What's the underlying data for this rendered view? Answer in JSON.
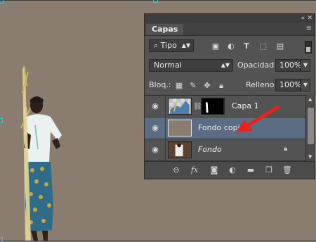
{
  "panel": {
    "tab_label": "Capas",
    "collapse_icon": "double-chevron-left-icon",
    "close_icon": "close-icon",
    "menu_icon": "panel-menu-icon"
  },
  "filter": {
    "type_label": "Tipo",
    "icons": [
      "image-filter-icon",
      "adjustment-filter-icon",
      "text-filter-icon",
      "shape-filter-icon",
      "smart-object-filter-icon"
    ]
  },
  "blend": {
    "mode": "Normal",
    "opacity_label": "Opacidad:",
    "opacity_value": "100%"
  },
  "lock": {
    "label": "Bloq.:",
    "fill_label": "Relleno:",
    "fill_value": "100%"
  },
  "layers": [
    {
      "name": "Capa 1",
      "selected": false,
      "has_mask": true,
      "locked": false
    },
    {
      "name": "Fondo copia",
      "selected": true,
      "has_mask": false,
      "locked": false
    },
    {
      "name": "Fondo",
      "selected": false,
      "has_mask": false,
      "locked": true
    }
  ],
  "bottom_icons": [
    "link-layers-icon",
    "fx-icon",
    "add-mask-icon",
    "adjustment-layer-icon",
    "new-group-icon",
    "new-layer-icon",
    "trash-icon"
  ],
  "colors": {
    "canvas_bg": "#8a7d6f",
    "panel_bg": "#535353",
    "selected_layer": "#5c6c82",
    "arrow": "#e8231e"
  }
}
